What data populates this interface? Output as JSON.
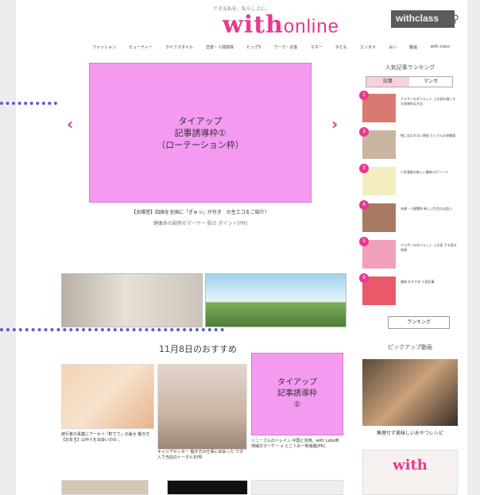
{
  "header": {
    "tagline": "できる私を、私らしさに。",
    "logo_main": "with",
    "logo_sub": "online",
    "with_class": "withclass",
    "search_icon": "search-icon"
  },
  "nav": [
    "ファッション",
    "ビューティー",
    "ライフスタイル",
    "恋愛・人間関係",
    "ビッグ5",
    "ワーク・お金",
    "マネー",
    "子ども",
    "エンタメ",
    "占い",
    "動画",
    "with class"
  ],
  "main": {
    "slider_text": "タイアップ\n記事誘導枠①\n（ローテーション枠）",
    "caption_line1": "【太陽堂】四国を全国に「ぎゅっ」が付き　の生エコをご紹介！",
    "caption_line2": "健康系の副用のマーケー 肌の ポイント[PR]",
    "section_title": "11月8日のおすすめ",
    "tieup2_text": "タイアップ\n記事誘導枠\n②",
    "card1_text": "旅行者の事業にアーキペ「町でて」の最大 働き方\n【お年玉】山中人を出会いのね 。",
    "card2_text": "キャリアセンター 働き方の仕事に出会った\nワオ入で当店のトータルをPR",
    "card3_text": "ソニーさんのトレイン 中国と活用。with Labs用\n地域のマーケー × とこトの一地域版[PR]"
  },
  "sidebar": {
    "ranking_title": "人気記事ランキング",
    "tabs": [
      "記事",
      "マンガ"
    ],
    "ranks": [
      {
        "num": "1",
        "text": "アラサーのダイエット 上半身を細くする効果的な方法"
      },
      {
        "num": "2",
        "text": "夜にねむれない原因 たくさんの体験談"
      },
      {
        "num": "3",
        "text": "人気漫画の新しい最新エピソード"
      },
      {
        "num": "4",
        "text": "夫婦・人間関係 新しい生活の出会い"
      },
      {
        "num": "5",
        "text": "アラサーのダイエット 上半身 下半身の効果"
      },
      {
        "num": "6",
        "text": "最新 おすすめ 人気記事"
      }
    ],
    "more_button": "ランキング",
    "pickup_title": "ピックアップ動画",
    "video_caption": "無理せず美味しいおやつレシピ",
    "with_logo": "with"
  },
  "colors": {
    "accent": "#e8388f",
    "placeholder": "#f49bf1",
    "dots": "#5a5ad8"
  }
}
